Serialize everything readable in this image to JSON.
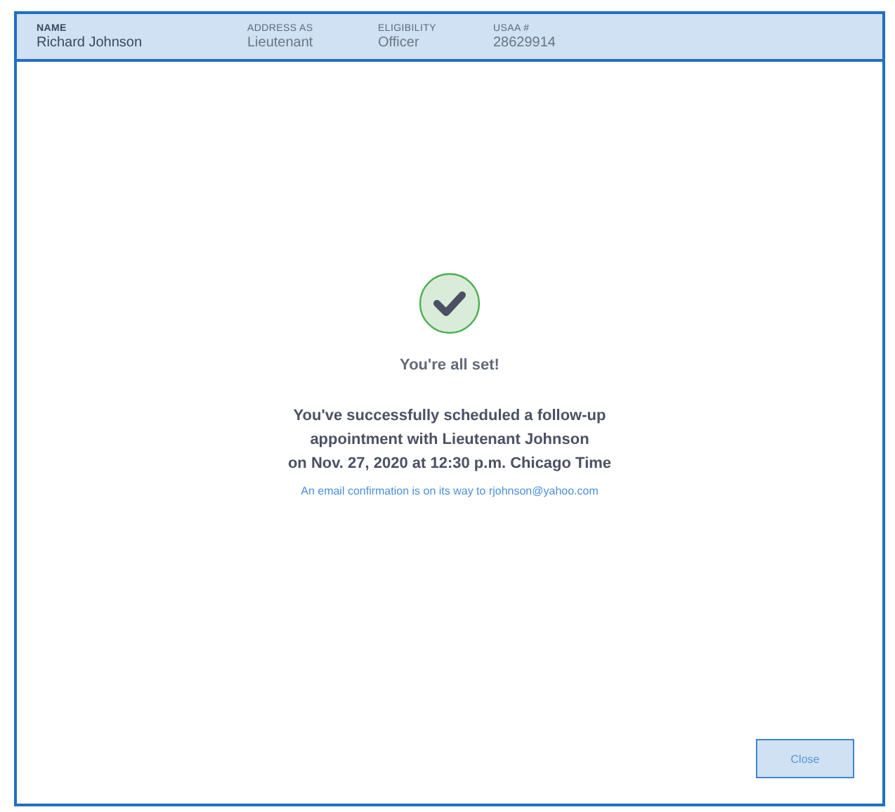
{
  "header": {
    "fields": [
      {
        "label": "NAME",
        "value": "Richard Johnson",
        "kind": "primary"
      },
      {
        "label": "ADDRESS AS",
        "value": "Lieutenant",
        "kind": "secondary"
      },
      {
        "label": "ELIGIBILITY",
        "value": "Officer",
        "kind": "secondary"
      },
      {
        "label": "USAA #",
        "value": "28629914",
        "kind": "secondary"
      }
    ]
  },
  "confirmation": {
    "title": "You're all set!",
    "message_lines": [
      "You've successfully scheduled a follow-up",
      "appointment with Lieutenant Johnson",
      "on Nov. 27, 2020 at 12:30 p.m. Chicago Time"
    ],
    "note": "An email confirmation is on its way to rjohnson@yahoo.com"
  },
  "buttons": [
    "Close"
  ]
}
